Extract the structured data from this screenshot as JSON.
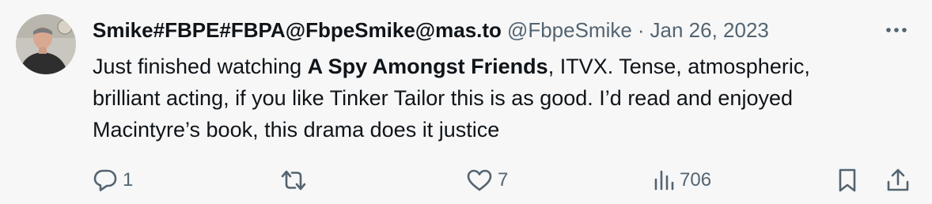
{
  "tweet": {
    "display_name": "Smike#FBPE#FBPA@FbpeSmike@mas.to",
    "handle": "@FbpeSmike",
    "separator": "·",
    "date": "Jan 26, 2023",
    "text": {
      "line1_pre": "Just finished watching ",
      "line1_bold": "A Spy Amongst Friends",
      "line1_post": ", ITVX. Tense, atmospheric,",
      "line2": "brilliant acting, if you like Tinker Tailor this is as good. I’d read and enjoyed",
      "line3": "Macintyre’s book, this drama does it justice"
    },
    "counts": {
      "replies": "1",
      "likes": "7",
      "views": "706"
    }
  },
  "icons": {
    "more": "more-icon",
    "reply": "reply-icon",
    "retweet": "retweet-icon",
    "like": "like-icon",
    "views": "views-icon",
    "bookmark": "bookmark-icon",
    "share": "share-icon"
  },
  "colors": {
    "background": "#f7f7f7",
    "text_primary": "#0f1419",
    "text_secondary": "#536471"
  }
}
